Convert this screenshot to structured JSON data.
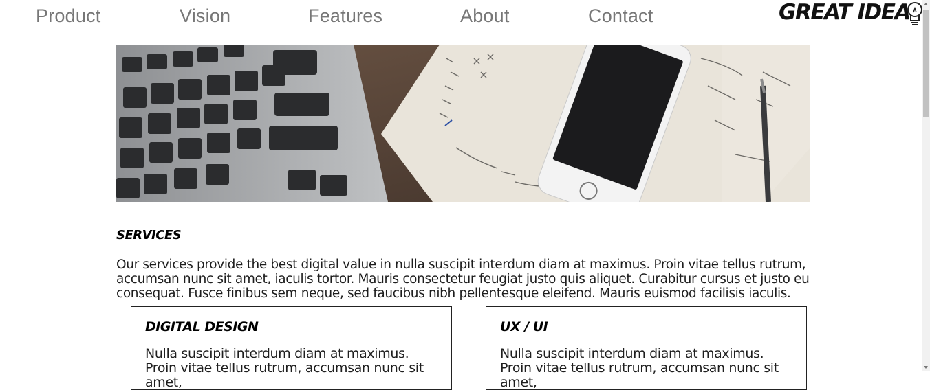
{
  "nav": {
    "items": [
      {
        "label": "Product"
      },
      {
        "label": "Vision"
      },
      {
        "label": "Features"
      },
      {
        "label": "About"
      },
      {
        "label": "Contact"
      }
    ],
    "logo_text": "GREAT IDEA"
  },
  "hero": {
    "icon": "workspace-photo",
    "colors": {
      "wood": "#5b4637",
      "laptop": "#a9abad",
      "paper": "#e9e4da",
      "phone": "#f0f0f0"
    }
  },
  "services": {
    "title": "SERVICES",
    "body": "Our services provide the best digital value in nulla suscipit interdum diam at maximus. Proin vitae tellus rutrum, accumsan nunc sit amet, iaculis tortor. Mauris consectetur feugiat justo quis aliquet. Curabitur cursus et justo eu consequat. Fusce finibus sem neque, sed faucibus nibh pellentesque eleifend. Mauris euismod facilisis iaculis."
  },
  "cards": [
    {
      "title": "DIGITAL DESIGN",
      "body": "Nulla suscipit interdum diam at maximus. Proin vitae tellus rutrum, accumsan nunc sit amet,"
    },
    {
      "title": "UX / UI",
      "body": "Nulla suscipit interdum diam at maximus. Proin vitae tellus rutrum, accumsan nunc sit amet,"
    }
  ]
}
